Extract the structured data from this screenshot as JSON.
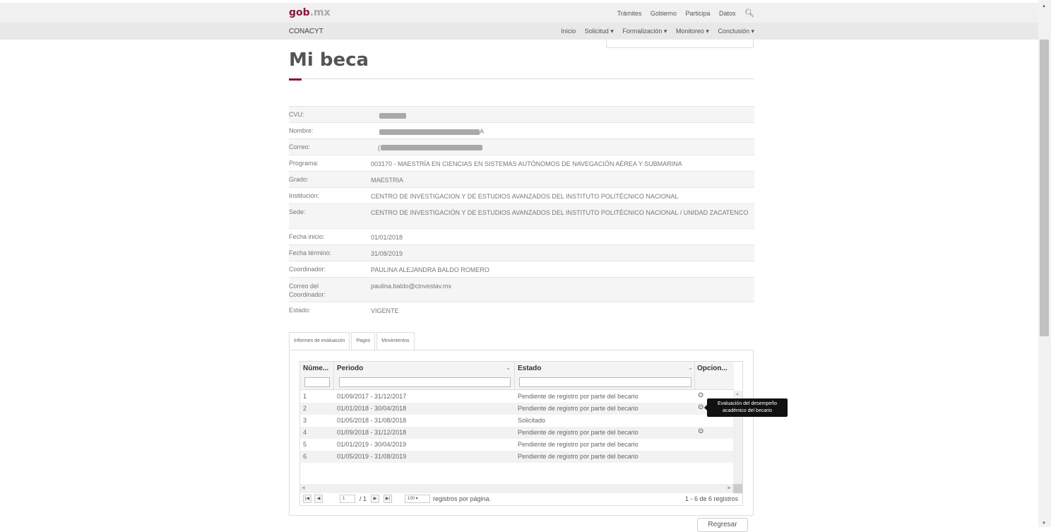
{
  "header": {
    "brand_bold": "gob",
    "brand_light": ".mx",
    "nav": [
      "Trámites",
      "Gobierno",
      "Participa",
      "Datos"
    ],
    "search_icon": "search-icon"
  },
  "subheader": {
    "brand": "CONACYT",
    "nav": [
      "Inicio",
      "Solicitud ▾",
      "Formalización ▾",
      "Monitoreo ▾",
      "Conclusión ▾"
    ]
  },
  "page_title": "Mi beca",
  "info": [
    {
      "label": "CVU:",
      "value": ""
    },
    {
      "label": "Nombre:",
      "value": "A"
    },
    {
      "label": "Correo:",
      "value": "(                                         nx"
    },
    {
      "label": "Programa:",
      "value": "003170 - MAESTRÍA EN CIENCIAS EN SISTEMAS AUTÓNOMOS DE NAVEGACIÓN AÉREA Y SUBMARINA"
    },
    {
      "label": "Grado:",
      "value": "MAESTRIA"
    },
    {
      "label": "Institución:",
      "value": "CENTRO DE INVESTIGACION Y DE ESTUDIOS AVANZADOS DEL INSTITUTO POLITÉCNICO NACIONAL"
    },
    {
      "label": "Sede:",
      "value": "CENTRO DE INVESTIGACIÓN Y DE ESTUDIOS AVANZADOS DEL INSTITUTO POLITÉCNICO NACIONAL / UNIDAD ZACATENCO"
    },
    {
      "label": "Fecha inicio:",
      "value": "01/01/2018"
    },
    {
      "label": "Fecha término:",
      "value": "31/08/2019"
    },
    {
      "label": "Coordinador:",
      "value": "PAULINA ALEJANDRA BALDO ROMERO"
    },
    {
      "label": "Correo del Coordinador:",
      "value": "paulina.baldo@cinvestav.mx"
    },
    {
      "label": "Estado:",
      "value": "VIGENTE"
    }
  ],
  "tabs": [
    "Informes de evaluación",
    "Pagos",
    "Movimientos"
  ],
  "grid": {
    "columns": [
      "Núme...",
      "Periodo",
      "Estado",
      "Opcion..."
    ],
    "rows": [
      {
        "num": "1",
        "periodo": "01/09/2017 - 31/12/2017",
        "estado": "Pendiente de registro por parte del becario",
        "icon": "⊙"
      },
      {
        "num": "2",
        "periodo": "01/01/2018 - 30/04/2018",
        "estado": "Pendiente de registro por parte del becario",
        "icon": "⊙"
      },
      {
        "num": "3",
        "periodo": "01/05/2018 - 31/08/2018",
        "estado": "Solicitado",
        "icon": ""
      },
      {
        "num": "4",
        "periodo": "01/09/2018 - 31/12/2018",
        "estado": "Pendiente de registro por parte del becario",
        "icon": "⊙"
      },
      {
        "num": "5",
        "periodo": "01/01/2019 - 30/04/2019",
        "estado": "Pendiente de registro por parte del becario",
        "icon": ""
      },
      {
        "num": "6",
        "periodo": "01/05/2019 - 31/08/2019",
        "estado": "Pendiente de registro por parte del becario",
        "icon": ""
      }
    ],
    "pager": {
      "page_input": "1",
      "page_total": "/ 1",
      "per_page": "100",
      "per_page_label": "registros por página.",
      "summary": "1 - 6 de 6 registros"
    }
  },
  "tooltip": "Evaluación del desempeño académico del becario",
  "back_button": "Regresar"
}
